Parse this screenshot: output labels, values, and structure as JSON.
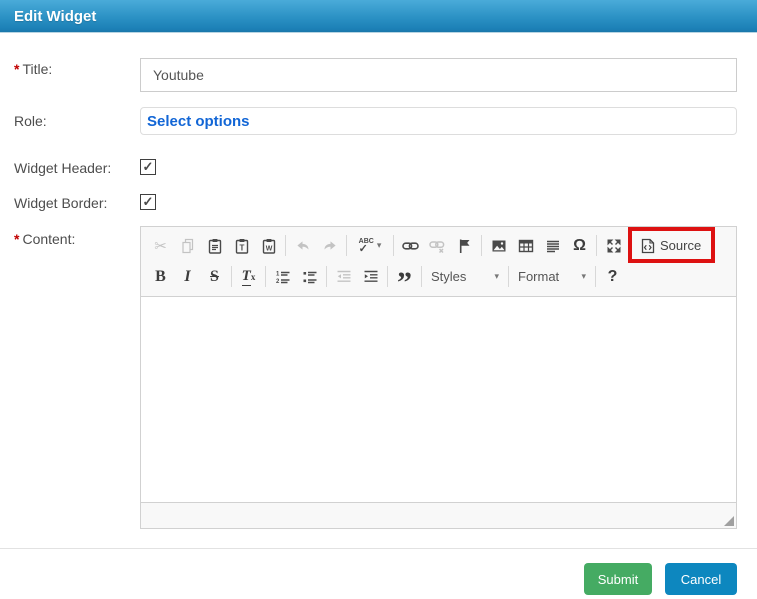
{
  "window": {
    "title": "Edit Widget"
  },
  "form": {
    "title": {
      "label": "Title:",
      "value": "Youtube",
      "required": true
    },
    "role": {
      "label": "Role:",
      "select_link": "Select options"
    },
    "widget_header": {
      "label": "Widget Header:",
      "checked": true
    },
    "widget_border": {
      "label": "Widget Border:",
      "checked": true
    },
    "content": {
      "label": "Content:",
      "required": true
    }
  },
  "glyphs": {
    "required": "*",
    "check": "✓",
    "dropdown_arrow": "▾",
    "cut": "✂",
    "spellcheck": "ABC",
    "paste_text": "T",
    "paste_word": "W",
    "bold": "B",
    "italic": "I",
    "strike": "S",
    "removeformat_t": "T",
    "removeformat_x": "x",
    "blockquote": "”",
    "omega": "Ω",
    "help": "?"
  },
  "editor": {
    "toolbar": {
      "styles_label": "Styles",
      "format_label": "Format",
      "source_label": "Source",
      "row1_icons": [
        "cut",
        "copy",
        "paste",
        "paste-plain-text",
        "paste-from-word",
        "undo",
        "redo",
        "spell-check",
        "link",
        "unlink",
        "anchor",
        "image",
        "table",
        "horizontal-line",
        "special-character",
        "maximize",
        "source"
      ],
      "row2_icons": [
        "bold",
        "italic",
        "strikethrough",
        "remove-format",
        "numbered-list",
        "bulleted-list",
        "decrease-indent",
        "increase-indent",
        "blockquote",
        "styles-dropdown",
        "format-dropdown",
        "about"
      ],
      "disabled_icons": [
        "cut",
        "copy",
        "undo",
        "redo",
        "unlink",
        "decrease-indent"
      ]
    },
    "content_value": ""
  },
  "actions": {
    "submit": "Submit",
    "cancel": "Cancel"
  },
  "colors": {
    "header_top": "#4aabd9",
    "header_bottom": "#1a77aa",
    "link_blue": "#1266d6",
    "required_red": "#c00000",
    "submit_green": "#45ab63",
    "cancel_blue": "#0d87bf",
    "highlight_red": "#dd1111"
  }
}
